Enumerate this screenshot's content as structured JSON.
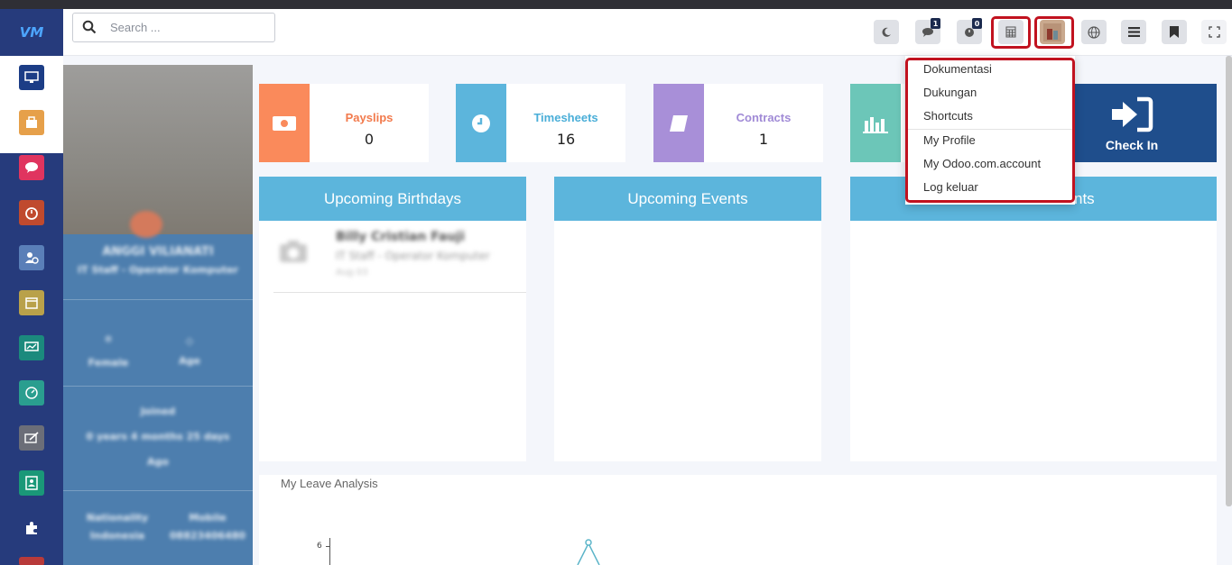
{
  "search": {
    "placeholder": "Search ..."
  },
  "topbar": {
    "buttons": [
      {
        "name": "dark-mode-toggle",
        "icon": "moon-icon"
      },
      {
        "name": "messages-button",
        "icon": "chat-icon",
        "badge": "1"
      },
      {
        "name": "activities-button",
        "icon": "clock-icon",
        "badge": "0"
      },
      {
        "name": "calculator-button",
        "icon": "calculator-icon"
      },
      {
        "name": "user-avatar-button",
        "icon": "avatar-icon"
      },
      {
        "name": "language-button",
        "icon": "globe-icon"
      },
      {
        "name": "menu-button",
        "icon": "hamburger-icon"
      },
      {
        "name": "bookmark-button",
        "icon": "bookmark-icon"
      },
      {
        "name": "fullscreen-button",
        "icon": "fullscreen-icon"
      }
    ]
  },
  "stats": [
    {
      "title": "Payslips",
      "value": "0",
      "color": "#fa8a5b",
      "titleColor": "#f27a4c"
    },
    {
      "title": "Timesheets",
      "value": "16",
      "color": "#5cb5dc",
      "titleColor": "#4aaed8"
    },
    {
      "title": "Contracts",
      "value": "1",
      "color": "#a88fd8",
      "titleColor": "#a08ad6"
    }
  ],
  "checkin": {
    "label": "Check In"
  },
  "panels": {
    "birthdays": "Upcoming Birthdays",
    "events": "Upcoming Events",
    "third_suffix": "nts"
  },
  "birthday_entry": {
    "name": "Billy Cristian Fauji",
    "role": "IT Staff - Operator Komputer",
    "date": "Aug 03"
  },
  "profile": {
    "name": "ANGGI VILIANATI",
    "role": "IT Staff - Operator Komputer",
    "gender": "Female",
    "age": "Age",
    "joined": "Joined",
    "tenure": "0 years 4 months 25 days",
    "tenure_label": "Ago",
    "nationality_label": "Nationality",
    "nationality": "Indonesia",
    "mobile_label": "Mobile",
    "mobile": "08823406480"
  },
  "leave": {
    "title": "My Leave Analysis",
    "y_tick": "6"
  },
  "dropdown": {
    "items": [
      "Dokumentasi",
      "Dukungan",
      "Shortcuts",
      "My Profile",
      "My Odoo.com.account",
      "Log keluar"
    ]
  },
  "colors": {
    "sidebar": "#263b7c",
    "panel_header": "#5cb5dc",
    "checkin": "#1f4e8c",
    "highlight": "#c1121f"
  }
}
